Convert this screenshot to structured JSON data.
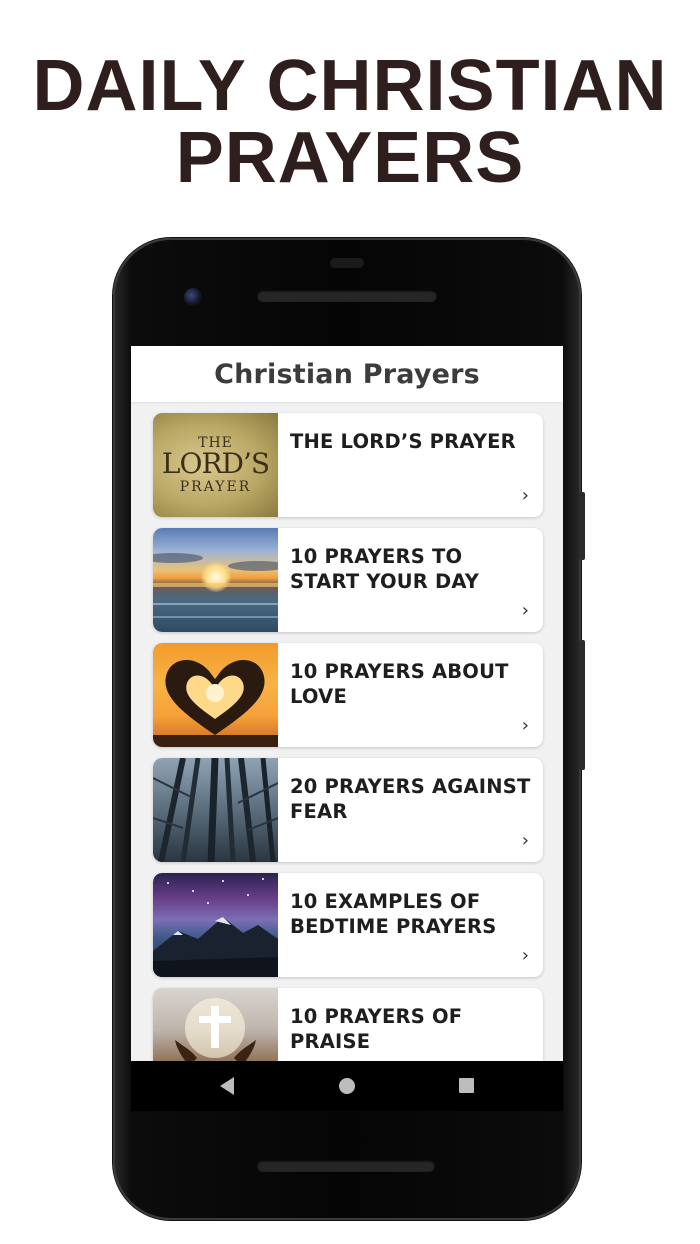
{
  "promo": {
    "headline_line1": "DAILY CHRISTIAN",
    "headline_line2": "PRAYERS"
  },
  "app": {
    "title": "Christian Prayers"
  },
  "items": [
    {
      "title": "THE LORD’S PRAYER",
      "thumbnail": "lords-prayer-parchment",
      "thumb_text": [
        "THE",
        "LORD’S",
        "PRAYER"
      ]
    },
    {
      "title": "10 PRAYERS TO START YOUR DAY",
      "thumbnail": "sunrise-over-sea"
    },
    {
      "title": "10 PRAYERS ABOUT LOVE",
      "thumbnail": "heart-hands-sunset"
    },
    {
      "title": "20 PRAYERS AGAINST FEAR",
      "thumbnail": "dark-forest-trees"
    },
    {
      "title": "10 EXAMPLES OF BEDTIME PRAYERS",
      "thumbnail": "night-sky-mountains"
    },
    {
      "title": "10 PRAYERS OF PRAISE",
      "thumbnail": "cross-raised-hands"
    }
  ],
  "icons": {
    "chevron": "chevron-right-icon",
    "nav_back": "back-triangle-icon",
    "nav_home": "home-circle-icon",
    "nav_recent": "recents-square-icon"
  },
  "colors": {
    "headline": "#2f1e1e",
    "screen_bg": "#f1f1f1",
    "card_bg": "#ffffff",
    "title_text": "#1e1e1e"
  }
}
